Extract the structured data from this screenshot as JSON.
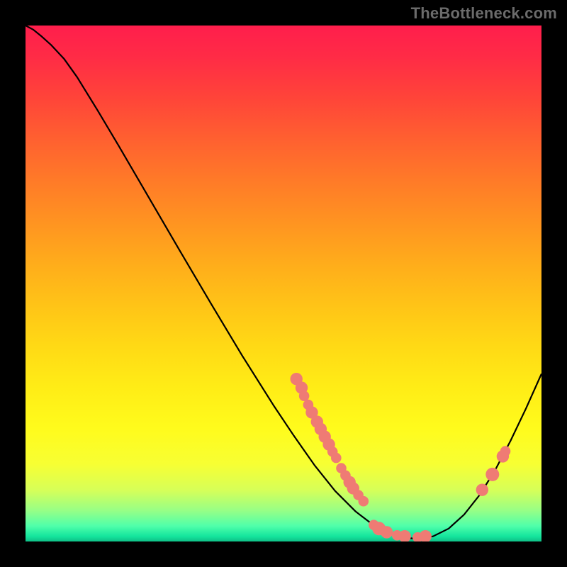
{
  "watermark": "TheBottleneck.com",
  "chart_data": {
    "type": "line",
    "title": "",
    "xlabel": "",
    "ylabel": "",
    "xlim": [
      0,
      100
    ],
    "ylim": [
      0,
      100
    ],
    "grid": false,
    "legend": false,
    "curve": [
      {
        "x": 0.0,
        "y": 100.0
      },
      {
        "x": 1.5,
        "y": 99.2
      },
      {
        "x": 3.0,
        "y": 98.0
      },
      {
        "x": 5.0,
        "y": 96.2
      },
      {
        "x": 7.5,
        "y": 93.5
      },
      {
        "x": 10.0,
        "y": 90.0
      },
      {
        "x": 14.0,
        "y": 83.5
      },
      {
        "x": 18.0,
        "y": 76.8
      },
      {
        "x": 24.0,
        "y": 66.5
      },
      {
        "x": 30.0,
        "y": 56.2
      },
      {
        "x": 36.0,
        "y": 46.0
      },
      {
        "x": 42.0,
        "y": 36.0
      },
      {
        "x": 48.0,
        "y": 26.5
      },
      {
        "x": 52.0,
        "y": 20.5
      },
      {
        "x": 56.0,
        "y": 14.8
      },
      {
        "x": 60.0,
        "y": 9.8
      },
      {
        "x": 64.0,
        "y": 5.8
      },
      {
        "x": 67.0,
        "y": 3.5
      },
      {
        "x": 70.0,
        "y": 1.8
      },
      {
        "x": 73.0,
        "y": 0.8
      },
      {
        "x": 76.0,
        "y": 0.5
      },
      {
        "x": 79.0,
        "y": 1.0
      },
      {
        "x": 82.0,
        "y": 2.5
      },
      {
        "x": 85.0,
        "y": 5.2
      },
      {
        "x": 88.0,
        "y": 9.0
      },
      {
        "x": 91.0,
        "y": 13.8
      },
      {
        "x": 94.0,
        "y": 19.5
      },
      {
        "x": 97.0,
        "y": 25.8
      },
      {
        "x": 100.0,
        "y": 32.5
      }
    ],
    "dots": [
      {
        "x": 52.5,
        "y": 31.5,
        "r": 1.2
      },
      {
        "x": 53.5,
        "y": 29.8,
        "r": 1.2
      },
      {
        "x": 54.0,
        "y": 28.2,
        "r": 1.0
      },
      {
        "x": 54.8,
        "y": 26.5,
        "r": 1.0
      },
      {
        "x": 55.5,
        "y": 25.0,
        "r": 1.2
      },
      {
        "x": 56.5,
        "y": 23.2,
        "r": 1.2
      },
      {
        "x": 57.2,
        "y": 21.8,
        "r": 1.2
      },
      {
        "x": 58.0,
        "y": 20.3,
        "r": 1.2
      },
      {
        "x": 58.8,
        "y": 18.8,
        "r": 1.2
      },
      {
        "x": 59.5,
        "y": 17.4,
        "r": 1.0
      },
      {
        "x": 60.2,
        "y": 16.2,
        "r": 1.0
      },
      {
        "x": 61.2,
        "y": 14.2,
        "r": 1.0
      },
      {
        "x": 62.0,
        "y": 12.8,
        "r": 1.0
      },
      {
        "x": 62.8,
        "y": 11.5,
        "r": 1.2
      },
      {
        "x": 63.5,
        "y": 10.3,
        "r": 1.2
      },
      {
        "x": 64.5,
        "y": 9.0,
        "r": 1.0
      },
      {
        "x": 65.5,
        "y": 7.8,
        "r": 1.0
      },
      {
        "x": 67.5,
        "y": 3.2,
        "r": 1.0
      },
      {
        "x": 68.5,
        "y": 2.5,
        "r": 1.3
      },
      {
        "x": 70.0,
        "y": 1.8,
        "r": 1.2
      },
      {
        "x": 72.0,
        "y": 1.2,
        "r": 1.0
      },
      {
        "x": 73.5,
        "y": 1.0,
        "r": 1.2
      },
      {
        "x": 76.0,
        "y": 0.8,
        "r": 1.0
      },
      {
        "x": 77.5,
        "y": 1.0,
        "r": 1.2
      },
      {
        "x": 88.5,
        "y": 10.0,
        "r": 1.2
      },
      {
        "x": 90.5,
        "y": 13.0,
        "r": 1.3
      },
      {
        "x": 92.5,
        "y": 16.5,
        "r": 1.2
      },
      {
        "x": 93.0,
        "y": 17.5,
        "r": 1.0
      }
    ],
    "colors": {
      "curve": "#000000",
      "dots": "#ef7b74",
      "gradient_top": "#ff1e4c",
      "gradient_mid": "#ffec16",
      "gradient_bottom": "#0fbf86"
    }
  }
}
